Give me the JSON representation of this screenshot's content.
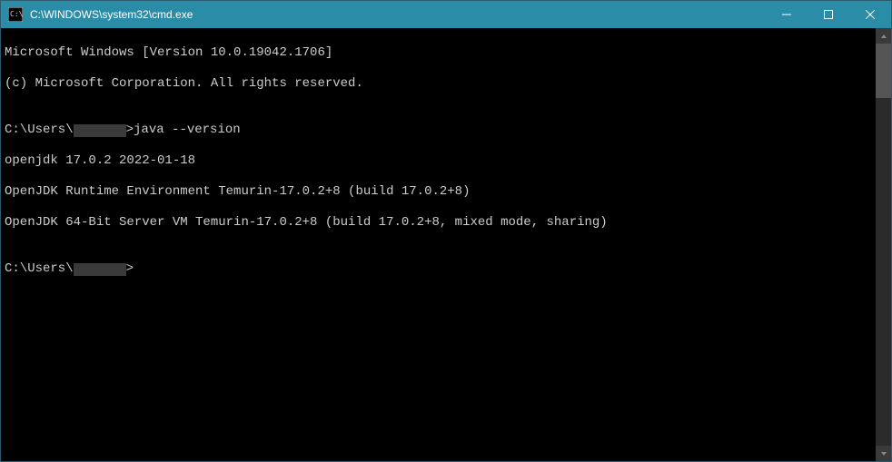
{
  "titlebar": {
    "title": "C:\\WINDOWS\\system32\\cmd.exe"
  },
  "terminal": {
    "banner1": "Microsoft Windows [Version 10.0.19042.1706]",
    "banner2": "(c) Microsoft Corporation. All rights reserved.",
    "blank1": "",
    "prompt1_prefix": "C:\\Users\\",
    "prompt1_suffix": ">",
    "cmd1": "java --version",
    "out1": "openjdk 17.0.2 2022-01-18",
    "out2": "OpenJDK Runtime Environment Temurin-17.0.2+8 (build 17.0.2+8)",
    "out3": "OpenJDK 64-Bit Server VM Temurin-17.0.2+8 (build 17.0.2+8, mixed mode, sharing)",
    "blank2": "",
    "prompt2_prefix": "C:\\Users\\",
    "prompt2_suffix": ">"
  }
}
